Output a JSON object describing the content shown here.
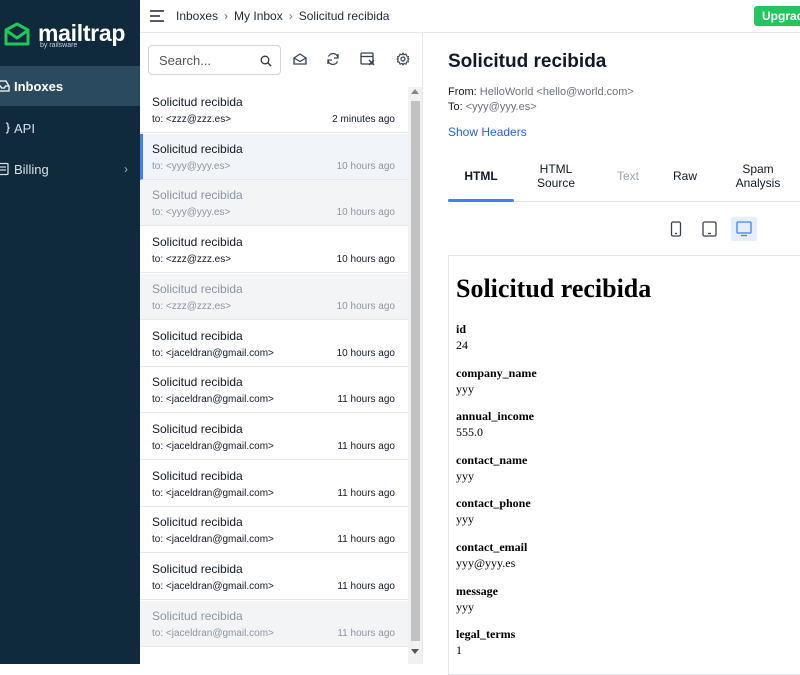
{
  "brand": {
    "name": "mailtrap",
    "sub": "by railsware",
    "accent": "#22c55e"
  },
  "sidebar": {
    "items": [
      {
        "label": "Inboxes",
        "icon": "inbox-icon"
      },
      {
        "label": "API",
        "icon": "api-icon"
      },
      {
        "label": "Billing",
        "icon": "billing-icon",
        "chevron": "›"
      }
    ]
  },
  "topbar": {
    "breadcrumbs": [
      "Inboxes",
      "My Inbox",
      "Solicitud recibida"
    ],
    "separator": "›",
    "upgrade_label": "Upgrade"
  },
  "toolbar": {
    "search_placeholder": "Search..."
  },
  "messages": [
    {
      "subject": "Solicitud recibida",
      "to": "to: <zzz@zzz.es>",
      "time": "2 minutes ago",
      "state": "unread"
    },
    {
      "subject": "Solicitud recibida",
      "to": "to: <yyy@yyy.es>",
      "time": "10 hours ago",
      "state": "selected"
    },
    {
      "subject": "Solicitud recibida",
      "to": "to: <yyy@yyy.es>",
      "time": "10 hours ago",
      "state": "read"
    },
    {
      "subject": "Solicitud recibida",
      "to": "to: <zzz@zzz.es>",
      "time": "10 hours ago",
      "state": "unread"
    },
    {
      "subject": "Solicitud recibida",
      "to": "to: <zzz@zzz.es>",
      "time": "10 hours ago",
      "state": "read"
    },
    {
      "subject": "Solicitud recibida",
      "to": "to: <jaceldran@gmail.com>",
      "time": "10 hours ago",
      "state": "unread"
    },
    {
      "subject": "Solicitud recibida",
      "to": "to: <jaceldran@gmail.com>",
      "time": "11 hours ago",
      "state": "unread"
    },
    {
      "subject": "Solicitud recibida",
      "to": "to: <jaceldran@gmail.com>",
      "time": "11 hours ago",
      "state": "unread"
    },
    {
      "subject": "Solicitud recibida",
      "to": "to: <jaceldran@gmail.com>",
      "time": "11 hours ago",
      "state": "unread"
    },
    {
      "subject": "Solicitud recibida",
      "to": "to: <jaceldran@gmail.com>",
      "time": "11 hours ago",
      "state": "unread"
    },
    {
      "subject": "Solicitud recibida",
      "to": "to: <jaceldran@gmail.com>",
      "time": "11 hours ago",
      "state": "unread"
    },
    {
      "subject": "Solicitud recibida",
      "to": "to: <jaceldran@gmail.com>",
      "time": "11 hours ago",
      "state": "read"
    }
  ],
  "detail": {
    "title": "Solicitud recibida",
    "from_label": "From:",
    "from_value": "HelloWorld <hello@world.com>",
    "to_label": "To:",
    "to_value": "<yyy@yyy.es>",
    "show_headers": "Show Headers",
    "tabs": [
      {
        "label": "HTML",
        "state": "active"
      },
      {
        "label": "HTML\nSource",
        "state": "normal"
      },
      {
        "label": "Text",
        "state": "disabled"
      },
      {
        "label": "Raw",
        "state": "normal"
      },
      {
        "label": "Spam\nAnalysis",
        "state": "normal"
      }
    ],
    "view_icons": [
      "mobile-view-icon",
      "tablet-view-icon",
      "desktop-view-icon"
    ],
    "preview": {
      "heading": "Solicitud recibida",
      "fields": [
        {
          "key": "id",
          "value": "24"
        },
        {
          "key": "company_name",
          "value": "yyy"
        },
        {
          "key": "annual_income",
          "value": "555.0"
        },
        {
          "key": "contact_name",
          "value": "yyy"
        },
        {
          "key": "contact_phone",
          "value": "yyy"
        },
        {
          "key": "contact_email",
          "value": "yyy@yyy.es"
        },
        {
          "key": "message",
          "value": "yyy"
        },
        {
          "key": "legal_terms",
          "value": "1"
        }
      ]
    }
  }
}
